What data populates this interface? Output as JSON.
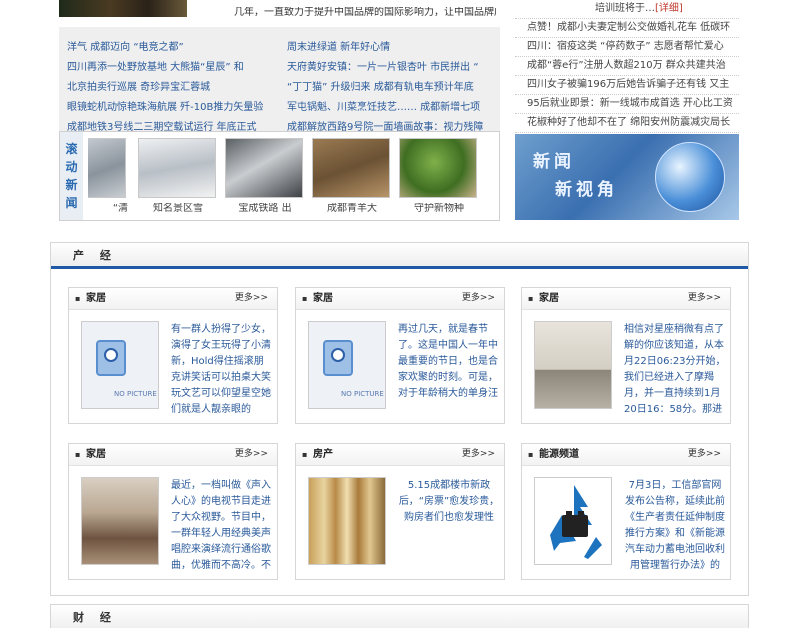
{
  "top": {
    "intro": "几年，一直致力于提升中国品牌的国际影响力，让中国品牌成为世界"
  },
  "news": {
    "left": [
      "洋气 成都迈向 “电竞之都”",
      "四川再添一处野放基地 大熊猫“星辰”  和",
      "北京拍卖行巡展 奇珍异宝汇蓉城",
      "眼镜蛇机动惊艳珠海航展 歼-10B推力矢量验",
      "成都地铁3号线二三期空载试运行 年底正式"
    ],
    "right": [
      "周末进绿道 新年好心情",
      "天府黄好安镇：一片一片银杏叶 市民拼出 “",
      "“丁丁猫” 升级归来 成都有轨电车预计年底",
      "军屯锅魁、川菜烹饪技艺…… 成都新增七项",
      "成都解放西路9号院一面墙画故事：视力残障"
    ]
  },
  "scroll": {
    "label": [
      "滚",
      "动",
      "新",
      "闻"
    ],
    "items": [
      "“清",
      "知名景区雪",
      "宝成铁路 出",
      "成都青羊大",
      "守护新物种"
    ]
  },
  "side": {
    "items": [
      {
        "text": "培训班将于…",
        "hot": "[详细]"
      },
      {
        "text": "点赞！成都小夫妻定制公交做婚礼花车 低碳环",
        "hot": ""
      },
      {
        "text": "四川：宿疫这类 “停药数子” 志愿者帮忙爱心",
        "hot": ""
      },
      {
        "text": "成都“蓉e行”注册人数超210万 群众共建共治",
        "hot": ""
      },
      {
        "text": "四川女子被骗196万后她告诉骗子还有钱 又主",
        "hot": ""
      },
      {
        "text": "95后就业即景：新一线城市成首选 开心比工资",
        "hot": ""
      },
      {
        "text": "花椒种好了他却不在了 绵阳安州防震减灾局长",
        "hot": ""
      }
    ],
    "banner_line1": "新闻",
    "banner_line2": "新视角"
  },
  "section1": {
    "title": "产 经",
    "cards": [
      {
        "title": "家居",
        "more": "更多>>",
        "image": "no-picture",
        "text": "有一群人扮得了少女，演得了女王玩得了小清新，Hold得住摇滚朋克讲笑话可以拍桌大笑玩文艺可以仰望星空她们就是人靓亲眼的",
        "center": false
      },
      {
        "title": "家居",
        "more": "更多>>",
        "image": "no-picture",
        "text": "再过几天，就是春节了。这是中国人一年中最重要的节日，也是合家欢聚的时刻。可是，对于年龄稍大的单身汪",
        "center": false
      },
      {
        "title": "家居",
        "more": "更多>>",
        "image": "living-room",
        "text": "相信对星座稍微有点了解的你应该知道，从本月22日06:23分开始，我们已经进入了摩羯月，并一直持续到1月20日16：58分。那进",
        "center": false
      },
      {
        "title": "家居",
        "more": "更多>>",
        "image": "bedroom",
        "text": "最近，一档叫做《声入人心》的电视节目走进了大众视野。节目中，一群年轻人用经典美声唱腔来演绎流行通俗歌曲，优雅而不高冷。不",
        "center": false
      },
      {
        "title": "房产",
        "more": "更多>>",
        "image": "buildings",
        "text": "5.15成都楼市新政后，“房票”愈发珍贵，购房者们也愈发理性",
        "center": true
      },
      {
        "title": "能源频道",
        "more": "更多>>",
        "image": "recycle",
        "text": "7月3日，工信部官网发布公告称，延续此前《生产者责任延伸制度推行方案》和《新能源汽车动力蓄电池回收利用管理暂行办法》的",
        "center": true
      }
    ]
  },
  "section2": {
    "title": "财 经"
  },
  "colors": {
    "accent": "#1f59a8",
    "link": "#2a5a9a",
    "hot": "#c0392b"
  }
}
